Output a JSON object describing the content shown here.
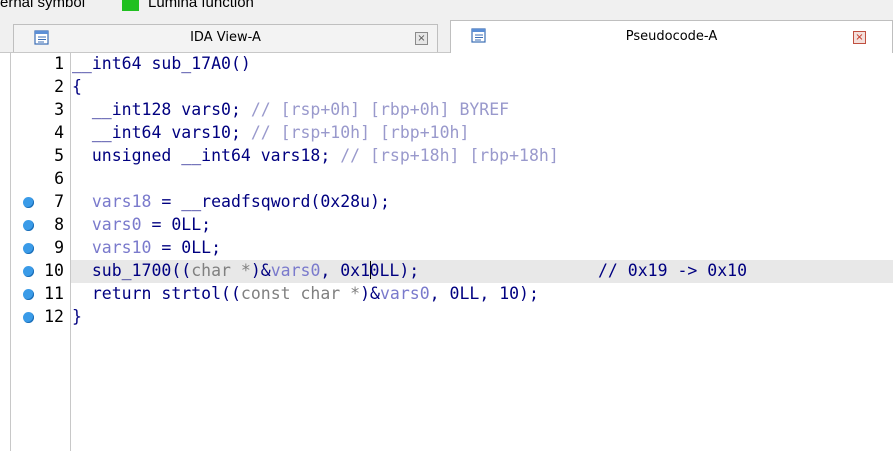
{
  "legend": {
    "external_symbol_label": "ernal symbol",
    "lumina_function_label": "Lumina function",
    "lumina_color": "#20c020"
  },
  "tabs": [
    {
      "label": "IDA View-A",
      "icon": "view-icon",
      "active": false
    },
    {
      "label": "Pseudocode-A",
      "icon": "pseudocode-icon",
      "active": true
    }
  ],
  "code": {
    "line_numbers": [
      "1",
      "2",
      "3",
      "4",
      "5",
      "6",
      "7",
      "8",
      "9",
      "10",
      "11",
      "12"
    ],
    "breakpoint_lines": [
      7,
      8,
      9,
      10,
      11,
      12
    ],
    "highlighted_line": 10,
    "l1": {
      "sig": "__int64 sub_17A0()"
    },
    "l2": {
      "text": "{"
    },
    "l3": {
      "decl": "__int128 vars0; ",
      "comment": "// [rsp+0h] [rbp+0h] BYREF"
    },
    "l4": {
      "decl": "__int64 vars10; ",
      "comment": "// [rsp+10h] [rbp+10h]"
    },
    "l5": {
      "decl": "unsigned __int64 vars18; ",
      "comment": "// [rsp+18h] [rbp+18h]"
    },
    "l7": {
      "lhs": "vars18",
      "rhs": " = __readfsqword(0x28u);"
    },
    "l8": {
      "lhs": "vars0",
      "rhs": " = 0LL;"
    },
    "l9": {
      "lhs": "vars10",
      "rhs": " = 0LL;"
    },
    "l10": {
      "call": "sub_1700((",
      "cast": "char *",
      "mid": ")&",
      "var": "vars0",
      "tail_a": ", 0x1",
      "tail_b": "0LL);",
      "comment": "// 0x19 -> 0x10"
    },
    "l11": {
      "ret": "return strtol((",
      "cast": "const char *",
      "mid": ")&",
      "var": "vars0",
      "tail": ", 0LL, 10);"
    },
    "l12": {
      "text": "}"
    }
  }
}
